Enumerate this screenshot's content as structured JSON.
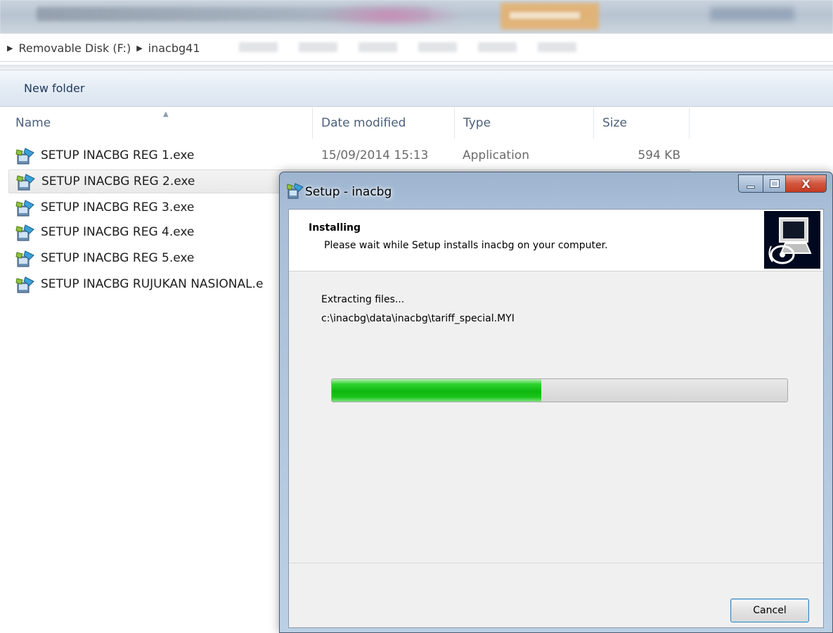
{
  "explorer": {
    "breadcrumbs": [
      "Removable Disk (F:)",
      "inacbg41"
    ],
    "toolbar": {
      "new_folder_label": "New folder"
    },
    "columns": {
      "name": "Name",
      "date": "Date modified",
      "type": "Type",
      "size": "Size"
    },
    "files": [
      {
        "name": "SETUP INACBG REG 1.exe",
        "date": "15/09/2014 15:13",
        "type": "Application",
        "size": "594 KB"
      },
      {
        "name": "SETUP INACBG REG 2.exe",
        "date": "",
        "type": "",
        "size": ""
      },
      {
        "name": "SETUP INACBG REG 3.exe",
        "date": "",
        "type": "",
        "size": ""
      },
      {
        "name": "SETUP INACBG REG 4.exe",
        "date": "",
        "type": "",
        "size": ""
      },
      {
        "name": "SETUP INACBG REG 5.exe",
        "date": "",
        "type": "",
        "size": ""
      },
      {
        "name": "SETUP INACBG RUJUKAN NASIONAL.e",
        "date": "",
        "type": "",
        "size": ""
      }
    ],
    "hovered_row": 1
  },
  "setup_dialog": {
    "title": "Setup - inacbg",
    "header_title": "Installing",
    "header_subtitle": "Please wait while Setup installs inacbg on your computer.",
    "status": "Extracting files...",
    "current_file": "c:\\inacbg\\data\\inacbg\\tariff_special.MYI",
    "progress_percent": 46,
    "cancel_label": "Cancel",
    "window_buttons": {
      "close_label": "X"
    }
  },
  "icons": {
    "file": "installer-exe-icon",
    "dialog": "setup-app-icon",
    "header_image": "computer-install-icon"
  },
  "colors": {
    "progress_green": "#0fb60f",
    "toolbar_text": "#1e395b",
    "close_red": "#c43b22",
    "dialog_frame": "#a9bfd8"
  }
}
